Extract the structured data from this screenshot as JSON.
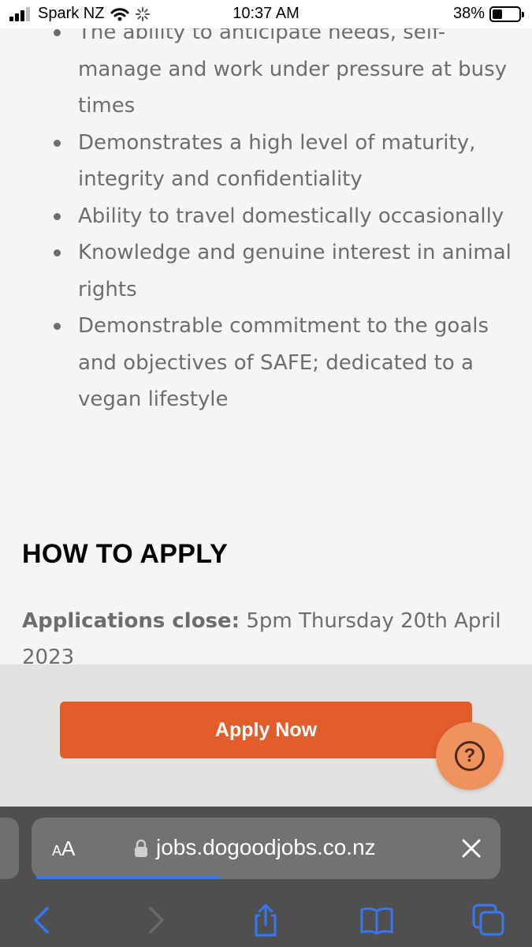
{
  "status_bar": {
    "carrier": "Spark NZ",
    "time": "10:37 AM",
    "battery_percent": "38%",
    "battery_level": 0.38,
    "icons": [
      "signal-icon",
      "wifi-icon",
      "loading-icon",
      "battery-icon"
    ]
  },
  "article": {
    "bullets": [
      "The ability to anticipate needs, self-manage and work under pressure at busy times",
      "Demonstrates a high level of maturity, integrity and confidentiality",
      "Ability to travel domestically occasionally",
      "Knowledge and genuine interest in animal rights",
      "Demonstrable commitment to the goals and objectives of SAFE; dedicated to a vegan lifestyle"
    ],
    "how_to_apply_heading": "HOW TO APPLY",
    "applications_close_label": "Applications close:",
    "applications_close_value": "5pm Thursday 20th April 2023"
  },
  "apply_bar": {
    "apply_label": "Apply Now",
    "help_label": "?"
  },
  "browser": {
    "text_size_label_small": "A",
    "text_size_label_large": "A",
    "url": "jobs.dogoodjobs.co.nz",
    "page_load_progress": 0.4,
    "toolbar": [
      "back-icon",
      "forward-icon",
      "share-icon",
      "bookmarks-icon",
      "tabs-icon"
    ]
  },
  "colors": {
    "accent_orange": "#e25d2a",
    "help_orange": "#f0925e",
    "browser_chrome": "#4f4f4f",
    "link_blue": "#3478f6"
  }
}
